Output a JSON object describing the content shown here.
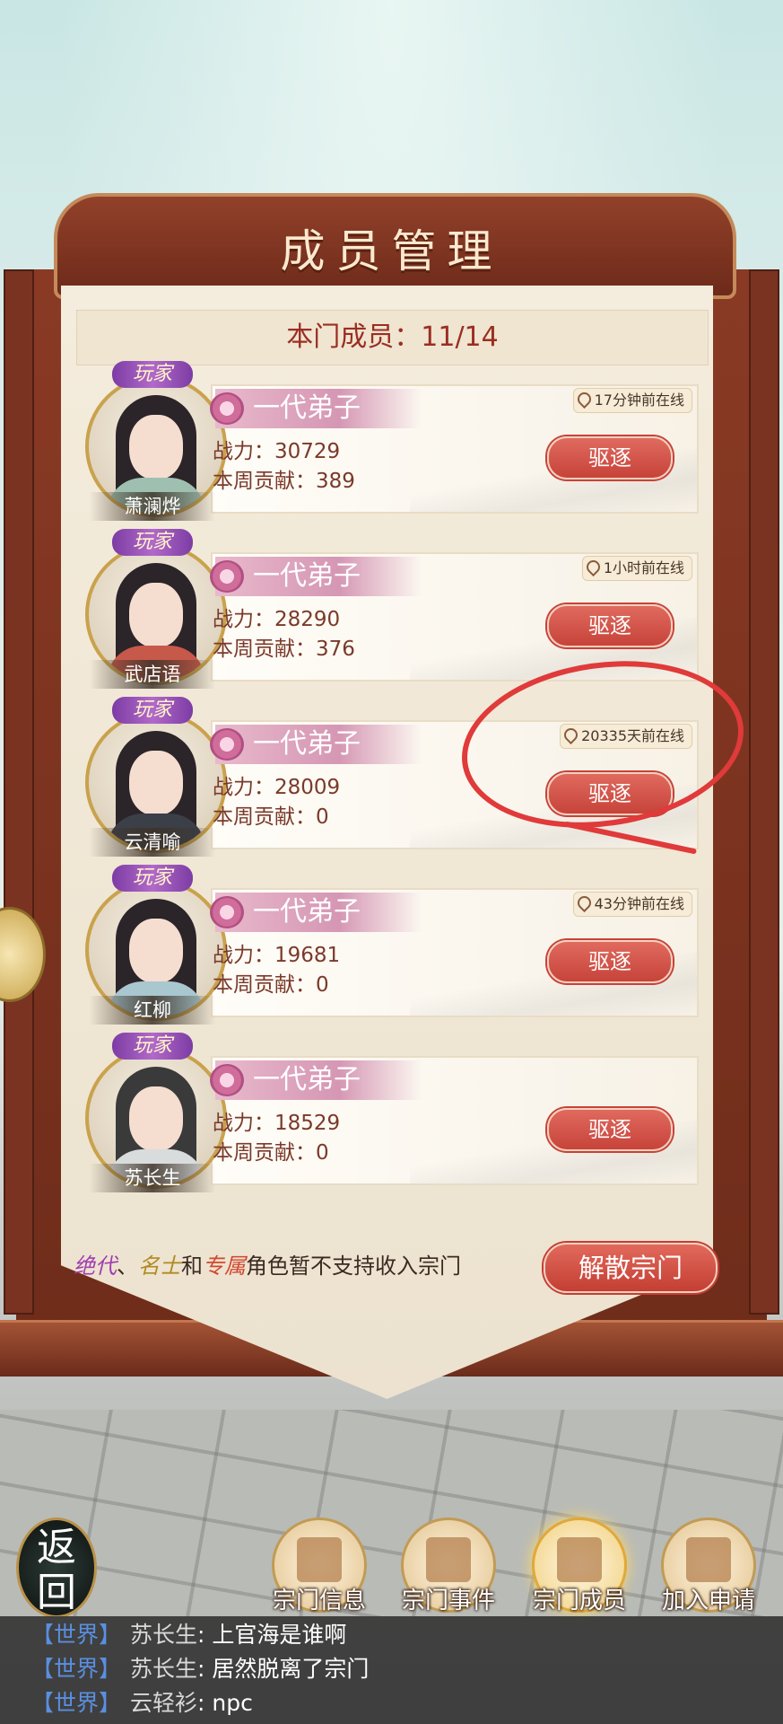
{
  "header": {
    "title": "成员管理",
    "member_count": "本门成员：11/14"
  },
  "members": [
    {
      "name": "萧澜烨",
      "rank": "一代弟子",
      "power": "战力：30729",
      "contribution": "本周贡献：389",
      "online": "17分钟前在线",
      "tag": "玩家",
      "kick_label": "驱逐"
    },
    {
      "name": "武店语",
      "rank": "一代弟子",
      "power": "战力：28290",
      "contribution": "本周贡献：376",
      "online": "1小时前在线",
      "tag": "玩家",
      "kick_label": "驱逐"
    },
    {
      "name": "云清喻",
      "rank": "一代弟子",
      "power": "战力：28009",
      "contribution": "本周贡献：0",
      "online": "20335天前在线",
      "tag": "玩家",
      "kick_label": "驱逐"
    },
    {
      "name": "红柳",
      "rank": "一代弟子",
      "power": "战力：19681",
      "contribution": "本周贡献：0",
      "online": "43分钟前在线",
      "tag": "玩家",
      "kick_label": "驱逐"
    },
    {
      "name": "苏长生",
      "rank": "一代弟子",
      "power": "战力：18529",
      "contribution": "本周贡献：0",
      "online": "",
      "tag": "玩家",
      "kick_label": "驱逐"
    }
  ],
  "footer": {
    "note_q1": "绝代",
    "note_sep1": "、",
    "note_q2": "名士",
    "note_and": "和",
    "note_q3": "专属",
    "note_tail": "角色暂不支持收入宗门",
    "disband_label": "解散宗门"
  },
  "nav": {
    "back_label": "返回",
    "items": [
      {
        "label": "宗门信息",
        "icon": "scroll-icon"
      },
      {
        "label": "宗门事件",
        "icon": "brush-icon"
      },
      {
        "label": "宗门成员",
        "icon": "members-icon"
      },
      {
        "label": "加入申请",
        "icon": "application-icon"
      }
    ],
    "active_index": 2
  },
  "chat": [
    {
      "channel": "【世界】",
      "sender": "苏长生",
      "message": ": 上官海是谁啊"
    },
    {
      "channel": "【世界】",
      "sender": "苏长生",
      "message": ": 居然脱离了宗门"
    },
    {
      "channel": "【世界】",
      "sender": "云轻衫",
      "message": ": npc"
    }
  ],
  "colors": {
    "accent_red": "#c7433a",
    "wood": "#7a3320",
    "annotation": "#e03a3a"
  }
}
